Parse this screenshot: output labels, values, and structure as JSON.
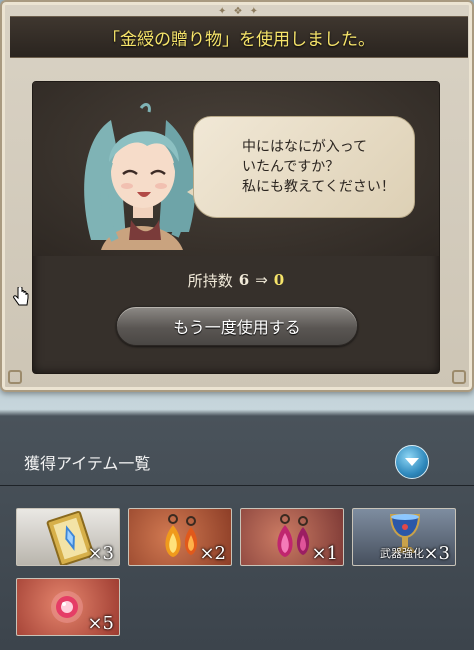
{
  "dialog": {
    "title": "「金綬の贈り物」を使用しました。",
    "speech_lines": [
      "中にはなにが入って",
      "いたんですか？",
      "私にも教えてください！"
    ],
    "count_label": "所持数",
    "count_before": "6",
    "arrow": "⇒",
    "count_after": "0",
    "reuse_button_label": "もう一度使用する",
    "character": "character-portrait"
  },
  "items": {
    "title": "獲得アイテム一覧",
    "expand_icon": "chevron-down-icon",
    "tiles": [
      {
        "icon": "golden-card-icon",
        "quantity": "×3",
        "tag": ""
      },
      {
        "icon": "fire-earrings-icon",
        "quantity": "×2",
        "tag": ""
      },
      {
        "icon": "dark-earrings-icon",
        "quantity": "×1",
        "tag": ""
      },
      {
        "icon": "chalice-icon",
        "quantity": "×3",
        "tag": "武器強化"
      },
      {
        "icon": "red-orb-icon",
        "quantity": "×5",
        "tag": ""
      }
    ]
  },
  "colors": {
    "title_yellow": "#f6e46a",
    "button_blue": "#2f89bd"
  }
}
